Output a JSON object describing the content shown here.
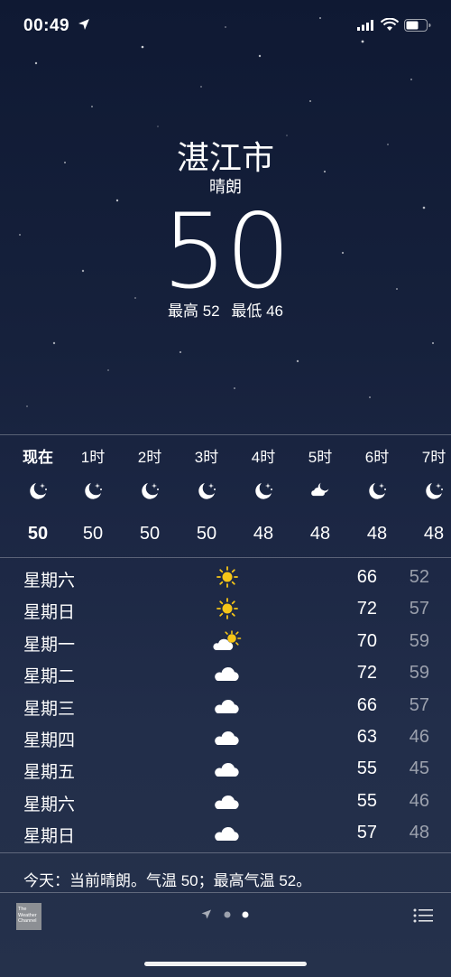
{
  "status_bar": {
    "time": "00:49"
  },
  "current": {
    "city": "湛江市",
    "condition": "晴朗",
    "temperature": "50",
    "high": "最高 52",
    "low": "最低 46"
  },
  "hourly": [
    {
      "label": "现在",
      "icon": "moon-stars-icon",
      "temp": "50"
    },
    {
      "label": "1时",
      "icon": "moon-stars-icon",
      "temp": "50"
    },
    {
      "label": "2时",
      "icon": "moon-stars-icon",
      "temp": "50"
    },
    {
      "label": "3时",
      "icon": "moon-stars-icon",
      "temp": "50"
    },
    {
      "label": "4时",
      "icon": "moon-stars-icon",
      "temp": "48"
    },
    {
      "label": "5时",
      "icon": "cloud-moon-icon",
      "temp": "48"
    },
    {
      "label": "6时",
      "icon": "moon-stars-icon",
      "temp": "48"
    },
    {
      "label": "7时",
      "icon": "moon-stars-icon",
      "temp": "48"
    }
  ],
  "daily": [
    {
      "day": "星期六",
      "icon": "sun-icon",
      "high": "66",
      "low": "52"
    },
    {
      "day": "星期日",
      "icon": "sun-icon",
      "high": "72",
      "low": "57"
    },
    {
      "day": "星期一",
      "icon": "partly-cloudy-icon",
      "high": "70",
      "low": "59"
    },
    {
      "day": "星期二",
      "icon": "cloud-icon",
      "high": "72",
      "low": "59"
    },
    {
      "day": "星期三",
      "icon": "cloud-icon",
      "high": "66",
      "low": "57"
    },
    {
      "day": "星期四",
      "icon": "cloud-icon",
      "high": "63",
      "low": "46"
    },
    {
      "day": "星期五",
      "icon": "cloud-icon",
      "high": "55",
      "low": "45"
    },
    {
      "day": "星期六",
      "icon": "cloud-icon",
      "high": "55",
      "low": "46"
    },
    {
      "day": "星期日",
      "icon": "cloud-icon",
      "high": "57",
      "low": "48"
    }
  ],
  "summary": "今天：当前晴朗。气温 50；最高气温 52。",
  "footer": {
    "logo_text": "The Weather Channel"
  },
  "colors": {
    "sun": "#f5c518",
    "background_top": "#0f1933",
    "background_bottom": "#25314b"
  }
}
